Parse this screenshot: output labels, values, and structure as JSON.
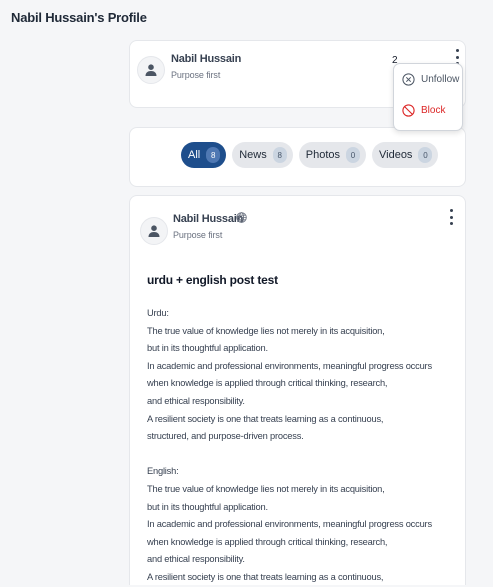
{
  "page": {
    "title": "Nabil Hussain's Profile"
  },
  "profile": {
    "name": "Nabil Hussain",
    "tagline": "Purpose first",
    "follower_count": "2"
  },
  "menu": {
    "unfollow_label": "Unfollow",
    "block_label": "Block"
  },
  "filters": [
    {
      "label": "All",
      "count": "8",
      "active": true
    },
    {
      "label": "News",
      "count": "8"
    },
    {
      "label": "Photos",
      "count": "0"
    },
    {
      "label": "Videos",
      "count": "0"
    }
  ],
  "post": {
    "author": "Nabil Hussain",
    "tagline": "Purpose first",
    "visibility_icon": "globe-icon",
    "title": "urdu + english post test",
    "lines": [
      "Urdu:",
      "The true value of knowledge lies not merely in its acquisition,",
      "but in its thoughtful application.",
      "In academic and professional environments, meaningful progress occurs",
      "when knowledge is applied through critical thinking, research,",
      "and ethical responsibility.",
      "A resilient society is one that treats learning as a continuous,",
      "structured, and purpose-driven process.",
      "",
      "English:",
      "The true value of knowledge lies not merely in its acquisition,",
      "but in its thoughtful application.",
      "In academic and professional environments, meaningful progress occurs",
      "when knowledge is applied through critical thinking, research,",
      "and ethical responsibility.",
      "A resilient society is one that treats learning as a continuous,"
    ]
  },
  "colors": {
    "accent": "#1e4e8c",
    "danger": "#dc2626",
    "background": "#f5f6f8"
  }
}
